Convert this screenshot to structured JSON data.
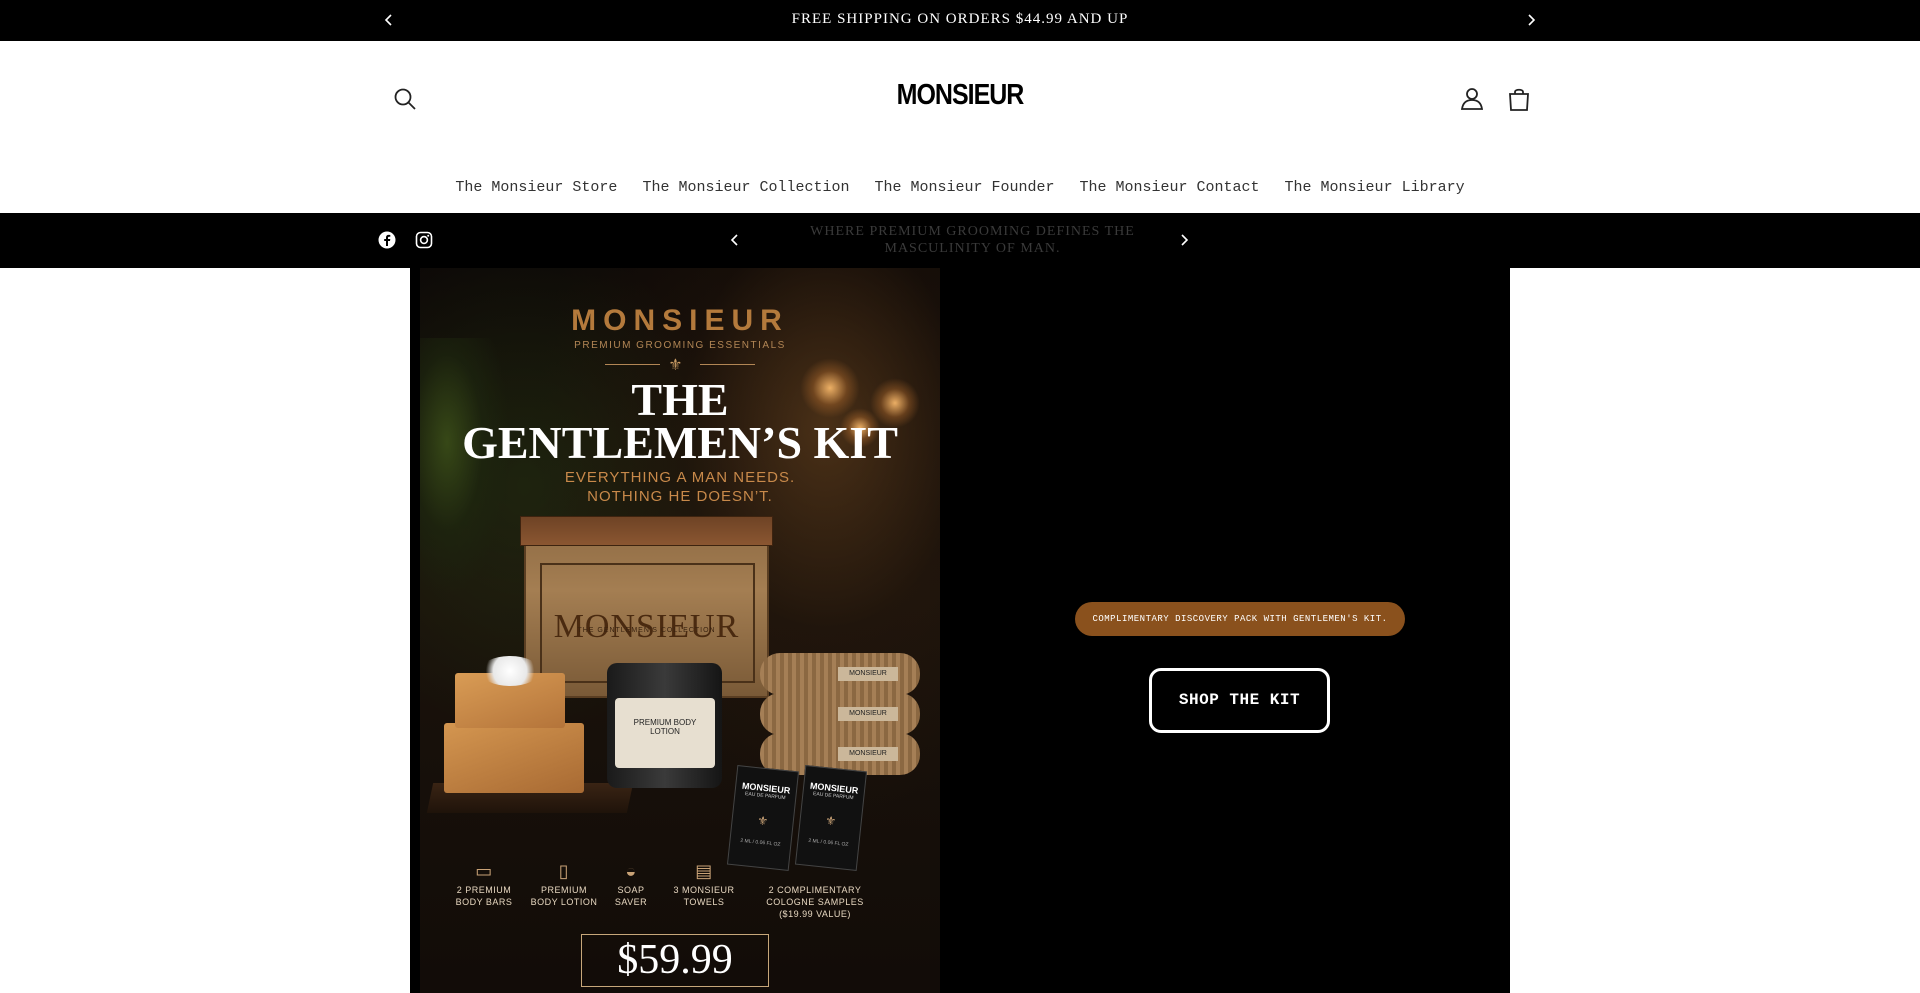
{
  "announcement": {
    "text": "FREE SHIPPING ON ORDERS $44.99 AND UP",
    "prev_icon": "chevron-left-icon",
    "next_icon": "chevron-right-icon"
  },
  "header": {
    "logo": "MONSIEUR",
    "search_icon": "search-icon",
    "account_icon": "user-icon",
    "cart_icon": "cart-icon"
  },
  "nav": {
    "items": [
      {
        "label": "The Monsieur Store"
      },
      {
        "label": "The Monsieur Collection"
      },
      {
        "label": "The Monsieur Founder"
      },
      {
        "label": "The Monsieur Contact"
      },
      {
        "label": "The Monsieur Library"
      }
    ]
  },
  "subbar": {
    "social": [
      "facebook-icon",
      "instagram-icon"
    ],
    "tagline": "WHERE PREMIUM GROOMING DEFINES THE MASCULINITY OF MAN."
  },
  "hero": {
    "poster": {
      "brand": "MONSIEUR",
      "brand_sub": "PREMIUM GROOMING ESSENTIALS",
      "title_line1": "THE",
      "title_line2": "GENTLEMEN’S KIT",
      "tag_line1": "EVERYTHING A MAN NEEDS.",
      "tag_line2": "NOTHING HE DOESN’T.",
      "box_brand": "MONSIEUR",
      "box_sub": "THE GENTLEMEN'S COLLECTION",
      "jar_label": "PREMIUM BODY LOTION",
      "towel_label": "MONSIEUR",
      "sample_brand": "MONSIEUR",
      "sample_sub": "EAU DE PARFUM",
      "sample_size": "2 ML / 0.06 FL OZ",
      "contents": [
        {
          "icon": "soap-icon",
          "line1": "2 PREMIUM",
          "line2": "BODY BARS",
          "line3": ""
        },
        {
          "icon": "bottle-icon",
          "line1": "PREMIUM",
          "line2": "BODY LOTION",
          "line3": ""
        },
        {
          "icon": "soap-dish-icon",
          "line1": "SOAP",
          "line2": "SAVER",
          "line3": ""
        },
        {
          "icon": "towel-icon",
          "line1": "3 MONSIEUR",
          "line2": "TOWELS",
          "line3": ""
        },
        {
          "icon": "cologne-icon",
          "line1": "2 COMPLIMENTARY",
          "line2": "COLOGNE SAMPLES",
          "line3": "($19.99 VALUE)"
        }
      ],
      "price": "$59.99"
    },
    "promo_pill": "COMPLIMENTARY DISCOVERY PACK WITH GENTLEMEN'S KIT.",
    "cta_label": "SHOP THE KIT"
  },
  "colors": {
    "bar_bg": "#000000",
    "accent_brown": "#8a511d",
    "poster_gold": "#b47a3c"
  }
}
